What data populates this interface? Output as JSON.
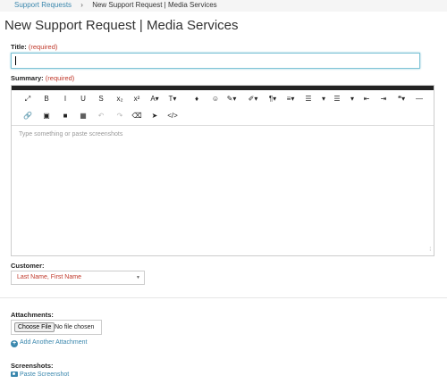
{
  "breadcrumb": {
    "parent": "Support Requests",
    "separator": "›",
    "current": "New Support Request | Media Services"
  },
  "page": {
    "title": "New Support Request | Media Services"
  },
  "title_field": {
    "label": "Title:",
    "required": "(required)",
    "value": ""
  },
  "summary_field": {
    "label": "Summary:",
    "required": "(required)",
    "placeholder": "Type something or paste screenshots"
  },
  "toolbar": {
    "row1": [
      {
        "glyph": "⤢",
        "icon": "fullscreen-icon"
      },
      {
        "glyph": "B",
        "icon": "bold-icon"
      },
      {
        "glyph": "I",
        "icon": "italic-icon"
      },
      {
        "glyph": "U",
        "icon": "underline-icon"
      },
      {
        "glyph": "S",
        "icon": "strikethrough-icon"
      },
      {
        "glyph": "x₂",
        "icon": "subscript-icon"
      },
      {
        "glyph": "x²",
        "icon": "superscript-icon"
      },
      {
        "glyph": "A▾",
        "icon": "font-family-icon"
      },
      {
        "glyph": "T▾",
        "icon": "font-size-icon"
      },
      {
        "glyph": "♦",
        "icon": "color-icon"
      },
      {
        "glyph": "☺",
        "icon": "emoticon-icon"
      },
      {
        "glyph": "✎▾",
        "icon": "paragraph-style-icon"
      },
      {
        "glyph": "✐▾",
        "icon": "inline-style-icon"
      },
      {
        "glyph": "¶▾",
        "icon": "paragraph-format-icon"
      },
      {
        "glyph": "≡▾",
        "icon": "align-icon"
      },
      {
        "glyph": "☰",
        "icon": "ordered-list-icon"
      },
      {
        "glyph": "▾",
        "icon": "ordered-list-dropdown-icon"
      },
      {
        "glyph": "☰",
        "icon": "unordered-list-icon"
      },
      {
        "glyph": "▾",
        "icon": "unordered-list-dropdown-icon"
      },
      {
        "glyph": "⇤",
        "icon": "outdent-icon"
      },
      {
        "glyph": "⇥",
        "icon": "indent-icon"
      },
      {
        "glyph": "❝▾",
        "icon": "quote-icon"
      },
      {
        "glyph": "—",
        "icon": "horizontal-line-icon"
      }
    ],
    "row2": [
      {
        "glyph": "🔗",
        "icon": "link-icon"
      },
      {
        "glyph": "▣",
        "icon": "image-icon"
      },
      {
        "glyph": "■",
        "icon": "video-icon"
      },
      {
        "glyph": "▦",
        "icon": "table-icon"
      },
      {
        "glyph": "↶",
        "icon": "undo-icon"
      },
      {
        "glyph": "↷",
        "icon": "redo-icon"
      },
      {
        "glyph": "⌫",
        "icon": "eraser-icon"
      },
      {
        "glyph": "➤",
        "icon": "select-all-icon"
      },
      {
        "glyph": "</>",
        "icon": "code-view-icon"
      }
    ]
  },
  "customer_field": {
    "label": "Customer:",
    "selected": "Last Name, First Name"
  },
  "attachments": {
    "label": "Attachments:",
    "choose_button": "Choose File",
    "status": "No file chosen",
    "add_link": "Add Another Attachment"
  },
  "screenshots": {
    "label": "Screenshots:",
    "paste_link": "Paste Screenshot"
  }
}
